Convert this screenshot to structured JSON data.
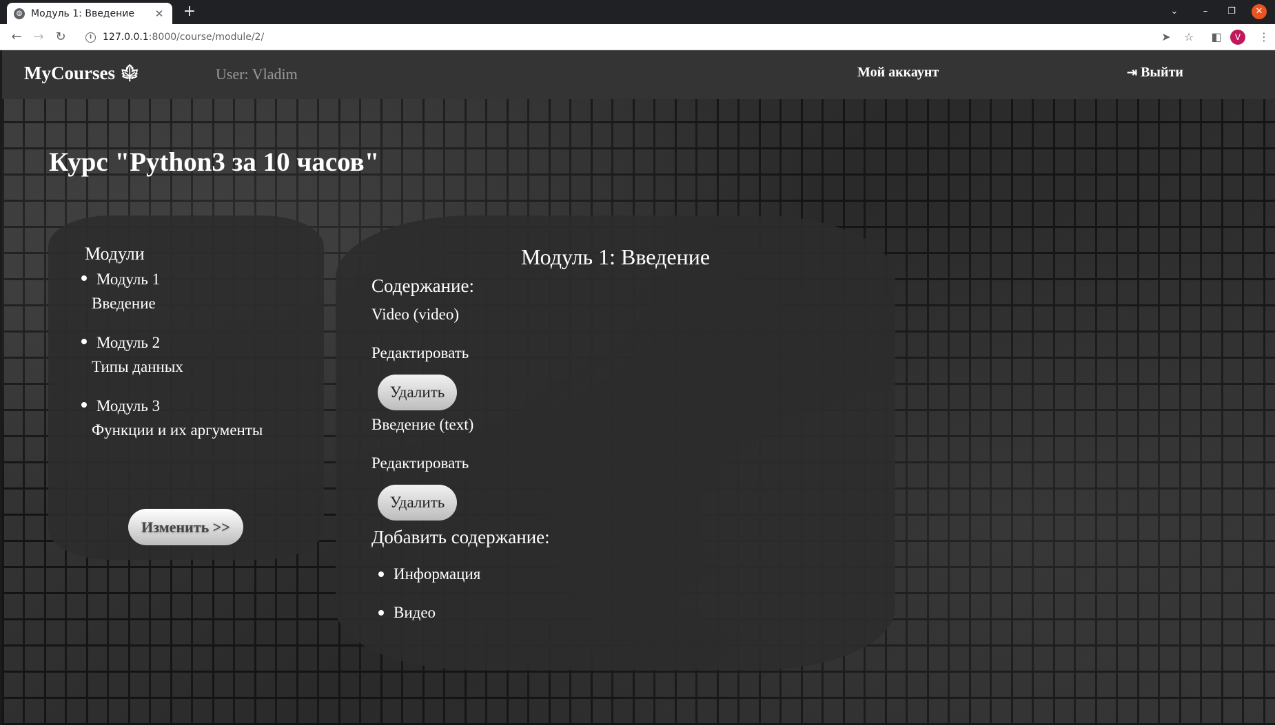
{
  "browser": {
    "tab_title": "Модуль 1: Введение",
    "url_host": "127.0.0.1",
    "url_path": ":8000/course/module/2/",
    "profile_initial": "V"
  },
  "navbar": {
    "brand": "MyCourses",
    "user": "User: Vladim",
    "account": "Мой аккаунт",
    "logout": "Выйти"
  },
  "course": {
    "title": "Курс \"Python3 за 10 часов\""
  },
  "modules": {
    "heading": "Модули",
    "items": [
      {
        "number": "Модуль 1",
        "title": "Введение"
      },
      {
        "number": "Модуль 2",
        "title": "Типы данных"
      },
      {
        "number": "Модуль 3",
        "title": "Функции и их аргументы"
      }
    ],
    "change_button": "Изменить >>"
  },
  "content": {
    "module_heading": "Модуль 1: Введение",
    "contents_label": "Содержание:",
    "items": [
      {
        "title": "Video (video)",
        "edit": "Редактировать",
        "delete": "Удалить"
      },
      {
        "title": "Введение (text)",
        "edit": "Редактировать",
        "delete": "Удалить"
      }
    ],
    "add_label": "Добавить содержание:",
    "add_options": [
      "Информация",
      "Видео"
    ]
  },
  "colors": {
    "navbar_bg": "#343434",
    "panel_bg": "#2d2d2d",
    "text": "#ffffff",
    "close_button": "#e95420",
    "profile": "#c2185b"
  }
}
